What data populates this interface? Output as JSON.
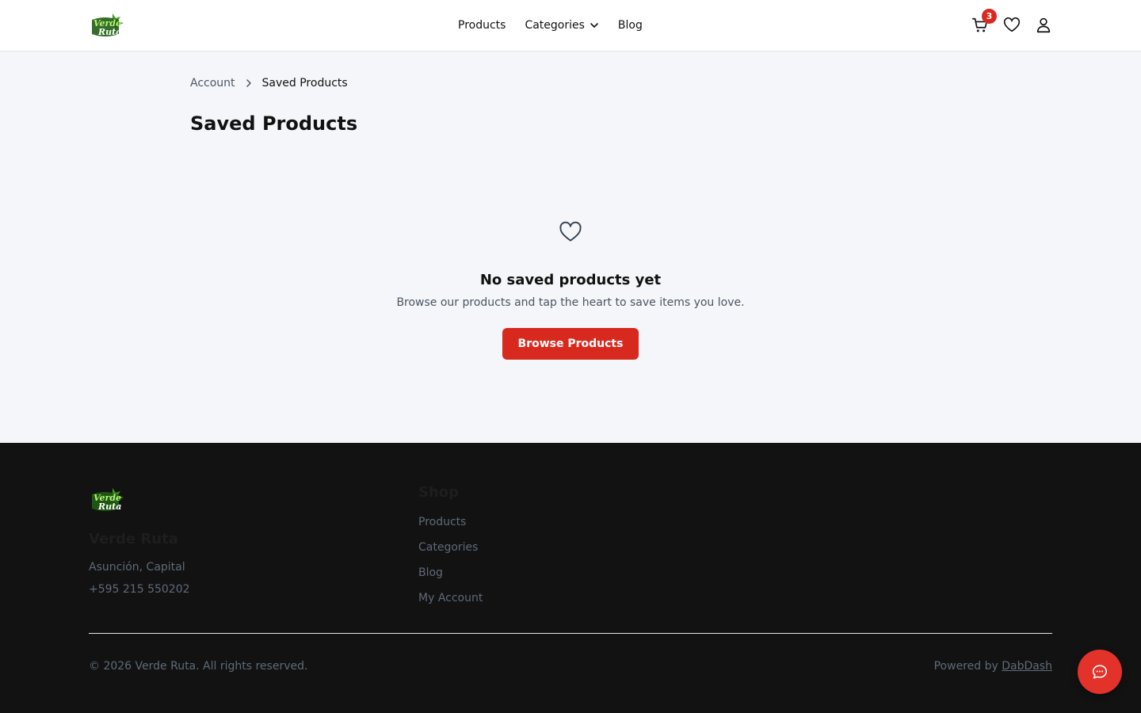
{
  "brand": {
    "logo_text_line1": "Verde",
    "logo_text_line2": "Ruta",
    "name": "Verde Ruta"
  },
  "nav": {
    "products": "Products",
    "categories": "Categories",
    "blog": "Blog"
  },
  "header_icons": {
    "cart_icon": "cart-icon",
    "cart_count": "3",
    "wishlist_icon": "heart-icon",
    "account_icon": "user-icon"
  },
  "breadcrumb": {
    "parent": "Account",
    "current": "Saved Products"
  },
  "page": {
    "title": "Saved Products"
  },
  "empty_state": {
    "icon": "heart-icon",
    "heading": "No saved products yet",
    "message": "Browse our products and tap the heart to save items you love.",
    "button": "Browse Products"
  },
  "footer": {
    "brand_name": "Verde Ruta",
    "address": "Asunción, Capital",
    "phone": "+595 215 550202",
    "shop_title": "Shop",
    "shop_links": [
      "Products",
      "Categories",
      "Blog",
      "My Account"
    ],
    "copyright": "© 2026 Verde Ruta. All rights reserved.",
    "powered_prefix": "Powered by",
    "powered_link": "DabDash"
  },
  "colors": {
    "accent": "#d8291f",
    "footer_bg": "#121212",
    "page_bg": "#f4f6f9",
    "logo_green": "#3a9a1f"
  }
}
